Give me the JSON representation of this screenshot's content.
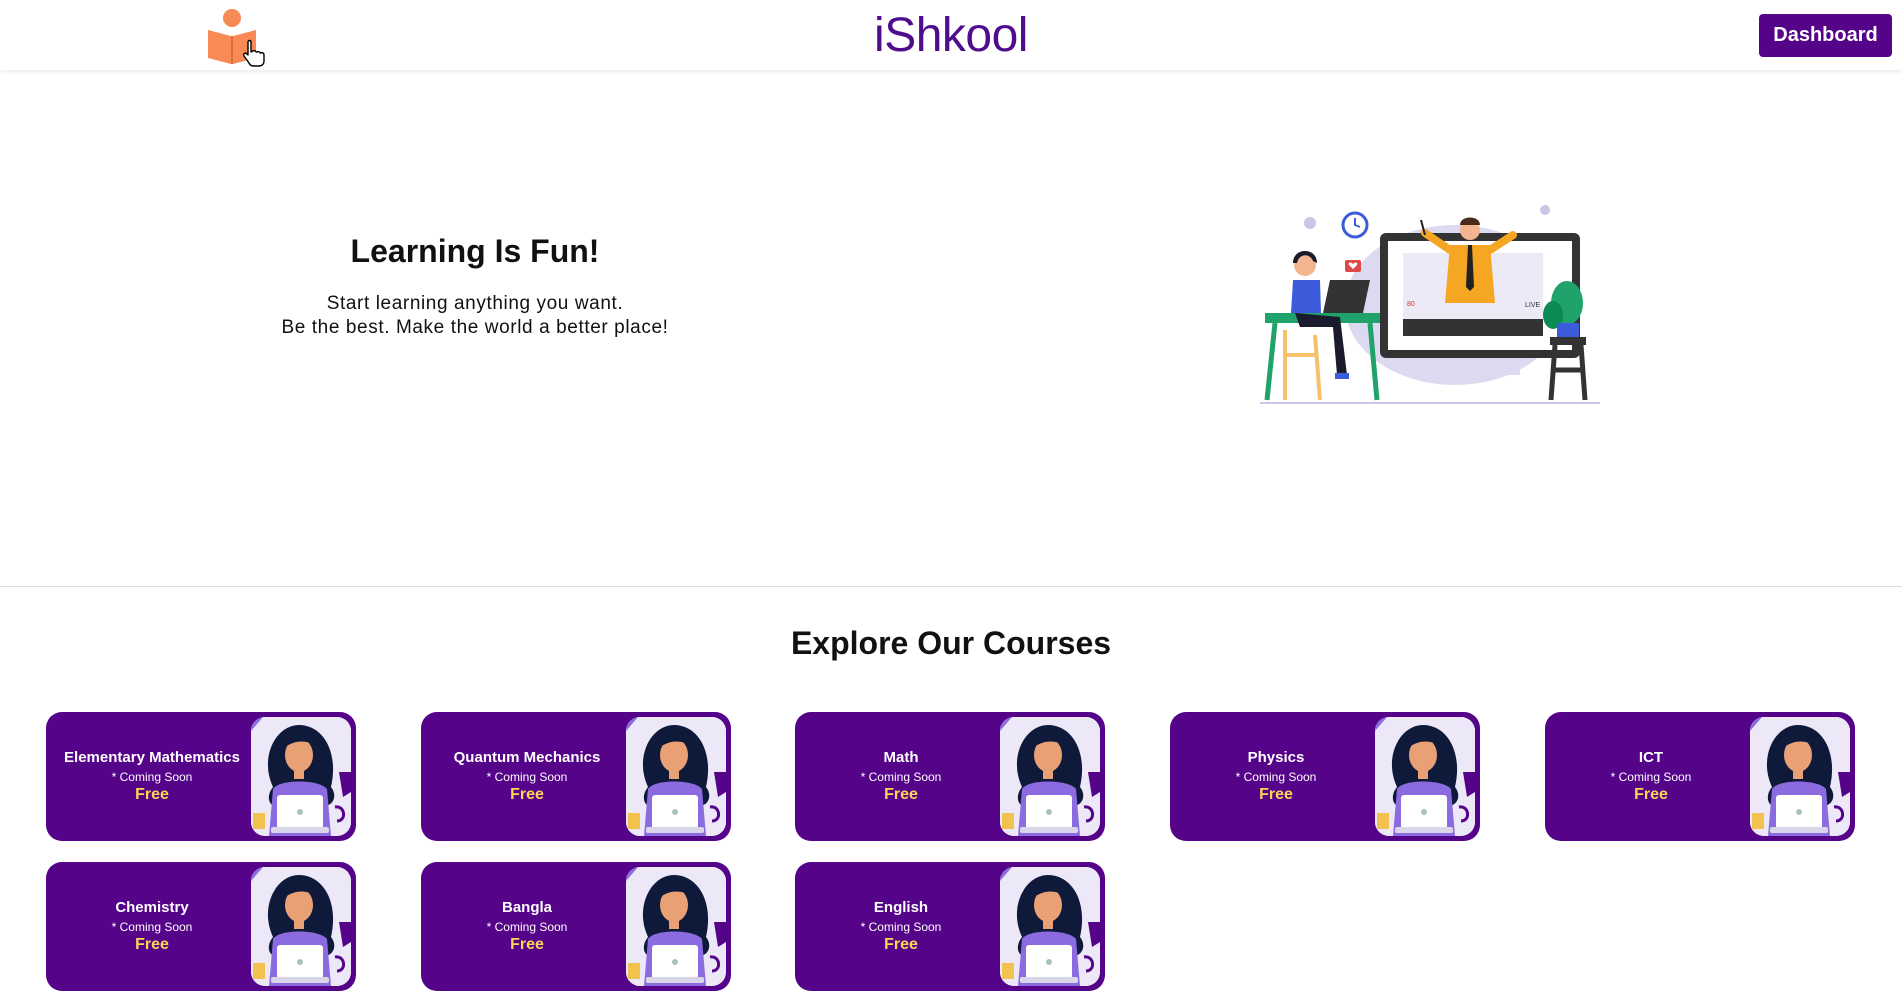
{
  "header": {
    "brand": "iShkool",
    "dashboard_label": "Dashboard"
  },
  "hero": {
    "title": "Learning Is Fun!",
    "subtitle_line1": "Start learning anything you want.",
    "subtitle_line2": "Be the best. Make the world a better place!",
    "illustration_live_label": "LIVE",
    "illustration_viewers": "80"
  },
  "courses_section": {
    "title": "Explore Our Courses",
    "courses": [
      {
        "title": "Elementary Mathematics",
        "status": "* Coming Soon",
        "price": "Free"
      },
      {
        "title": "Quantum Mechanics",
        "status": "* Coming Soon",
        "price": "Free"
      },
      {
        "title": "Math",
        "status": "* Coming Soon",
        "price": "Free"
      },
      {
        "title": "Physics",
        "status": "* Coming Soon",
        "price": "Free"
      },
      {
        "title": "ICT",
        "status": "* Coming Soon",
        "price": "Free"
      },
      {
        "title": "Chemistry",
        "status": "* Coming Soon",
        "price": "Free"
      },
      {
        "title": "Bangla",
        "status": "* Coming Soon",
        "price": "Free"
      },
      {
        "title": "English",
        "status": "* Coming Soon",
        "price": "Free"
      }
    ]
  },
  "colors": {
    "brand_purple": "#55048a",
    "price_yellow": "#ffd454",
    "logo_orange": "#f88a55"
  },
  "icons": {
    "logo": "reader-with-book-icon",
    "cursor": "hand-pointer-icon"
  }
}
